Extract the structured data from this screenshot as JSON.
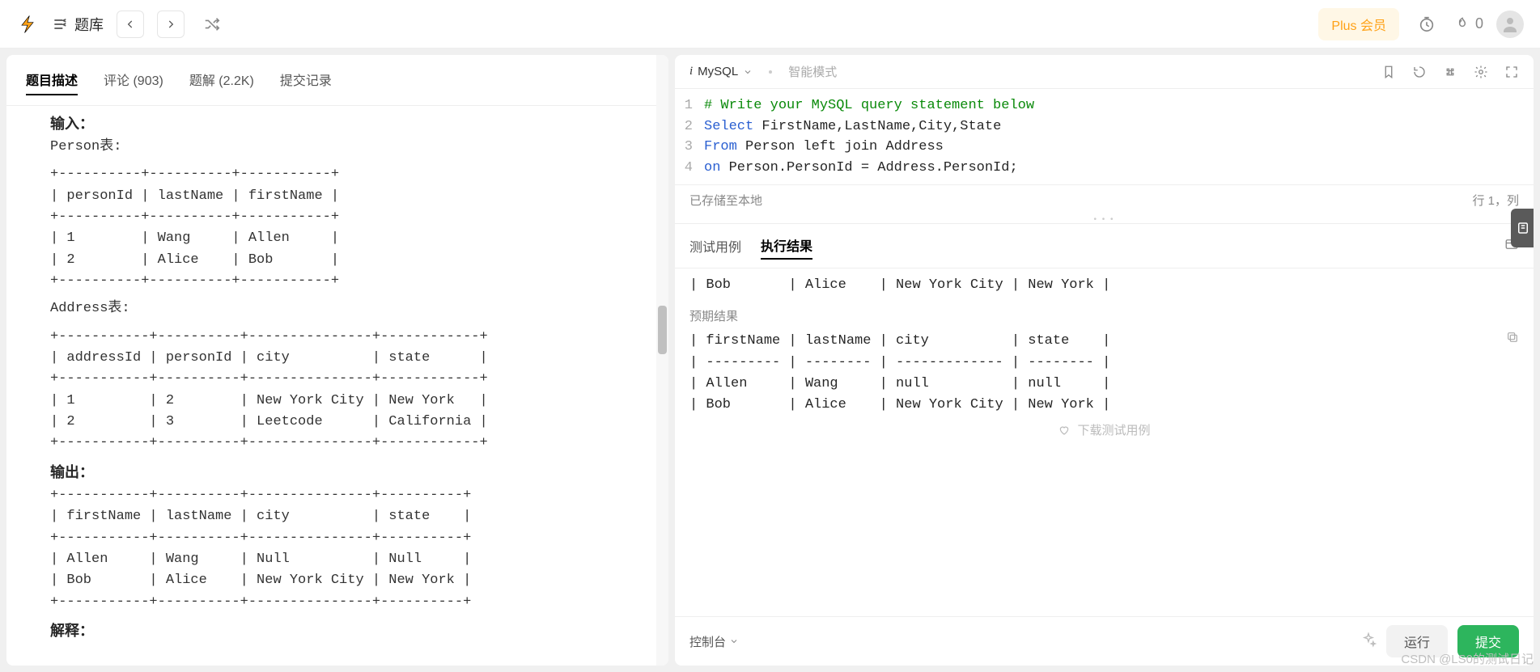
{
  "top": {
    "library_label": "题库",
    "plus_label": "Plus 会员",
    "fire_count": "0"
  },
  "left_tabs": {
    "description": "题目描述",
    "comments": "评论 (903)",
    "solutions": "题解 (2.2K)",
    "submissions": "提交记录"
  },
  "desc": {
    "input_heading": "输入：",
    "person_label": "Person表:",
    "person_table": "+----------+----------+-----------+\n| personId | lastName | firstName |\n+----------+----------+-----------+\n| 1        | Wang     | Allen     |\n| 2        | Alice    | Bob       |\n+----------+----------+-----------+",
    "address_label": "Address表:",
    "address_table": "+-----------+----------+---------------+------------+\n| addressId | personId | city          | state      |\n+-----------+----------+---------------+------------+\n| 1         | 2        | New York City | New York   |\n| 2         | 3        | Leetcode      | California |\n+-----------+----------+---------------+------------+",
    "output_heading": "输出：",
    "output_table": "+-----------+----------+---------------+----------+\n| firstName | lastName | city          | state    |\n+-----------+----------+---------------+----------+\n| Allen     | Wang     | Null          | Null     |\n| Bob       | Alice    | New York City | New York |\n+-----------+----------+---------------+----------+",
    "explain_heading": "解释："
  },
  "editor": {
    "language": "MySQL",
    "smart_mode": "智能模式",
    "lines": [
      {
        "n": "1",
        "segments": [
          {
            "t": "# Write your MySQL query statement below",
            "c": "c-comment"
          }
        ]
      },
      {
        "n": "2",
        "segments": [
          {
            "t": "Select",
            "c": "c-kw"
          },
          {
            "t": " FirstName,LastName,City,State",
            "c": ""
          }
        ]
      },
      {
        "n": "3",
        "segments": [
          {
            "t": "From",
            "c": "c-kw"
          },
          {
            "t": " Person left join Address",
            "c": ""
          }
        ]
      },
      {
        "n": "4",
        "segments": [
          {
            "t": "on",
            "c": "c-kw"
          },
          {
            "t": " Person.PersonId = Address.PersonId;",
            "c": ""
          }
        ]
      }
    ],
    "saved_label": "已存储至本地",
    "cursor_label": "行 1，列"
  },
  "result": {
    "tab_test": "测试用例",
    "tab_result": "执行结果",
    "output_row": "| Bob       | Alice    | New York City | New York |",
    "expected_label": "预期结果",
    "expected_table": "| firstName | lastName | city          | state    |\n| --------- | -------- | ------------- | -------- |\n| Allen     | Wang     | null          | null     |\n| Bob       | Alice    | New York City | New York |",
    "load_more_label": "下载测试用例"
  },
  "footer": {
    "console_label": "控制台",
    "run_label": "运行",
    "submit_label": "提交"
  },
  "watermark": "CSDN @LS0的测试日记"
}
